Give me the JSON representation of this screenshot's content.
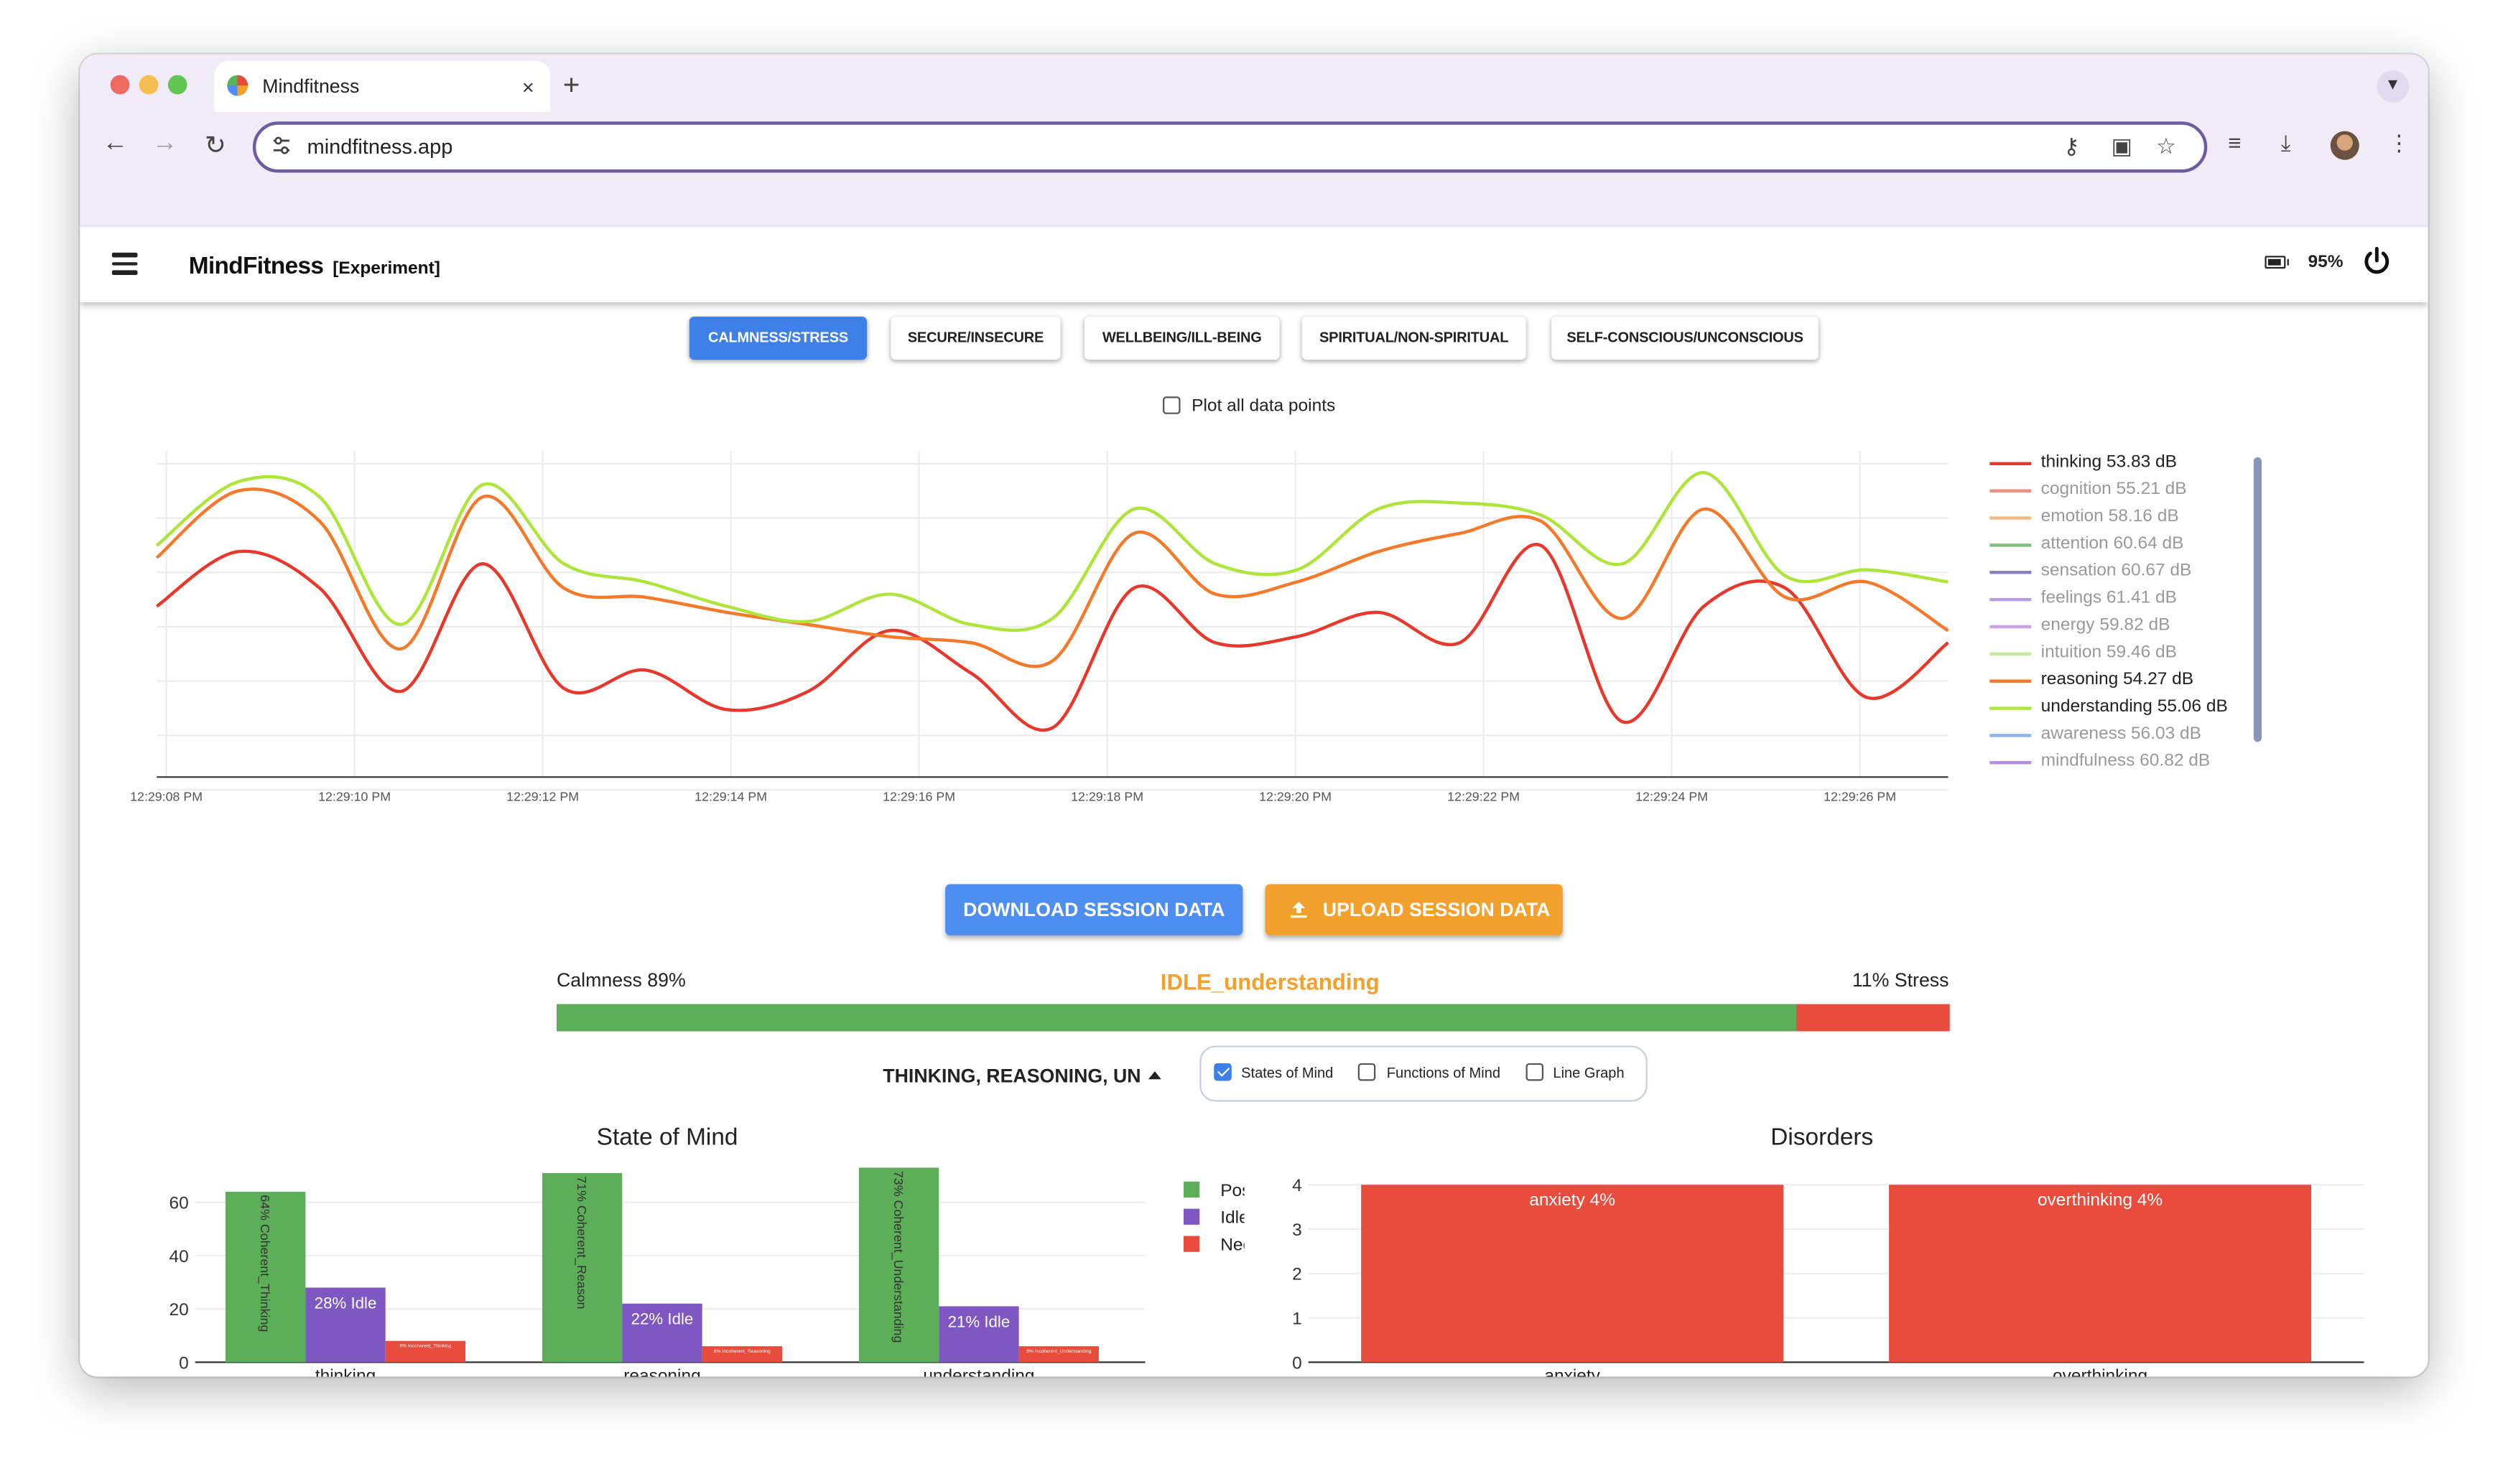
{
  "browser": {
    "tab_title": "Mindfitness",
    "tab_close": "×",
    "new_tab": "+",
    "url": "mindfitness.app"
  },
  "app": {
    "brand": "MindFitness",
    "tag": "[Experiment]",
    "battery_pct": "95%"
  },
  "categories": [
    {
      "label": "CALMNESS/STRESS",
      "active": true
    },
    {
      "label": "SECURE/INSECURE",
      "active": false
    },
    {
      "label": "WELLBEING/ILL-BEING",
      "active": false
    },
    {
      "label": "SPIRITUAL/NON-SPIRITUAL",
      "active": false
    },
    {
      "label": "SELF-CONSCIOUS/UNCONSCIOUS",
      "active": false
    }
  ],
  "plot_all_label": "Plot all data points",
  "plot_all_checked": false,
  "line_chart": {
    "x_ticks": [
      "12:29:08 PM",
      "12:29:10 PM",
      "12:29:12 PM",
      "12:29:14 PM",
      "12:29:16 PM",
      "12:29:18 PM",
      "12:29:20 PM",
      "12:29:22 PM",
      "12:29:24 PM",
      "12:29:26 PM"
    ],
    "legend": [
      {
        "label": "thinking 53.83 dB",
        "color": "#e8372b",
        "active": true
      },
      {
        "label": "cognition 55.21 dB",
        "color": "#f08c80",
        "active": false
      },
      {
        "label": "emotion 58.16 dB",
        "color": "#f5b880",
        "active": false
      },
      {
        "label": "attention 60.64 dB",
        "color": "#7fbf7f",
        "active": false
      },
      {
        "label": "sensation 60.67 dB",
        "color": "#8a7fc4",
        "active": false
      },
      {
        "label": "feelings 61.41 dB",
        "color": "#b79be0",
        "active": false
      },
      {
        "label": "energy 59.82 dB",
        "color": "#c9a3e6",
        "active": false
      },
      {
        "label": "intuition 59.46 dB",
        "color": "#c4eaa0",
        "active": false
      },
      {
        "label": "reasoning 54.27 dB",
        "color": "#f5792a",
        "active": true
      },
      {
        "label": "understanding 55.06 dB",
        "color": "#aee53a",
        "active": true
      },
      {
        "label": "awareness 56.03 dB",
        "color": "#8cb2f0",
        "active": false
      },
      {
        "label": "mindfulness 60.82 dB",
        "color": "#b68de0",
        "active": false
      }
    ]
  },
  "buttons": {
    "download": "DOWNLOAD SESSION DATA",
    "upload": "UPLOAD SESSION DATA",
    "download_color": "#4e8ef0",
    "upload_color": "#f4a02d"
  },
  "meter": {
    "left_label": "Calmness 89%",
    "right_label": "11% Stress",
    "state": "IDLE_understanding",
    "calmness_fraction": 0.89
  },
  "selector": {
    "value": "THINKING, REASONING, UN",
    "options": [
      {
        "label": "States of Mind",
        "checked": true
      },
      {
        "label": "Functions of Mind",
        "checked": false
      },
      {
        "label": "Line Graph",
        "checked": false
      }
    ]
  },
  "chart_data": [
    {
      "type": "line",
      "title": "",
      "x": [
        "12:29:08 PM",
        "12:29:10 PM",
        "12:29:12 PM",
        "12:29:14 PM",
        "12:29:16 PM",
        "12:29:18 PM",
        "12:29:20 PM",
        "12:29:22 PM",
        "12:29:24 PM",
        "12:29:26 PM"
      ],
      "series": [
        {
          "name": "thinking 53.83 dB",
          "color": "#e8372b",
          "values": [
            0.52,
            0.7,
            0.58,
            0.24,
            0.66,
            0.25,
            0.31,
            0.18,
            0.24,
            0.44,
            0.3,
            0.12,
            0.58,
            0.4,
            0.42,
            0.5,
            0.4,
            0.72,
            0.14,
            0.52,
            0.58,
            0.22,
            0.4
          ]
        },
        {
          "name": "reasoning 54.27 dB",
          "color": "#f5792a",
          "values": [
            0.68,
            0.9,
            0.8,
            0.38,
            0.88,
            0.58,
            0.55,
            0.5,
            0.46,
            0.42,
            0.4,
            0.34,
            0.76,
            0.56,
            0.6,
            0.7,
            0.76,
            0.8,
            0.48,
            0.84,
            0.55,
            0.6,
            0.44
          ]
        },
        {
          "name": "understanding 55.06 dB",
          "color": "#aee53a",
          "values": [
            0.72,
            0.93,
            0.88,
            0.46,
            0.92,
            0.66,
            0.6,
            0.52,
            0.47,
            0.56,
            0.46,
            0.48,
            0.84,
            0.66,
            0.64,
            0.84,
            0.86,
            0.82,
            0.66,
            0.96,
            0.62,
            0.64,
            0.6
          ]
        }
      ]
    },
    {
      "type": "bar",
      "title": "State of Mind",
      "categories": [
        "thinking",
        "reasoning",
        "understanding"
      ],
      "ylim": [
        0,
        72
      ],
      "y_ticks": [
        0,
        20,
        40,
        60
      ],
      "series": [
        {
          "name": "Positive",
          "color": "#5cae58",
          "values": [
            64,
            71,
            73
          ],
          "labels": [
            "64% Coherent_Thinking",
            "71% Coherent_Reason",
            "73% Coherent_Understanding"
          ]
        },
        {
          "name": "Idle",
          "color": "#7e57c2",
          "values": [
            28,
            22,
            21
          ],
          "labels": [
            "28% Idle",
            "22% Idle",
            "21% Idle"
          ]
        },
        {
          "name": "Negative",
          "color": "#e74c3c",
          "values": [
            8,
            6,
            6
          ],
          "labels": [
            "8% Incoherent_Thinking",
            "6% Incoherent_Reasoning",
            "6% Incoherent_Understanding"
          ]
        }
      ]
    },
    {
      "type": "bar",
      "title": "Disorders",
      "categories": [
        "anxiety",
        "overthinking"
      ],
      "ylim": [
        0,
        4
      ],
      "y_ticks": [
        0,
        1,
        2,
        3,
        4
      ],
      "series": [
        {
          "name": "",
          "color": "#e74c3c",
          "values": [
            4,
            4
          ],
          "labels": [
            "anxiety 4%",
            "overthinking 4%"
          ]
        }
      ]
    }
  ]
}
